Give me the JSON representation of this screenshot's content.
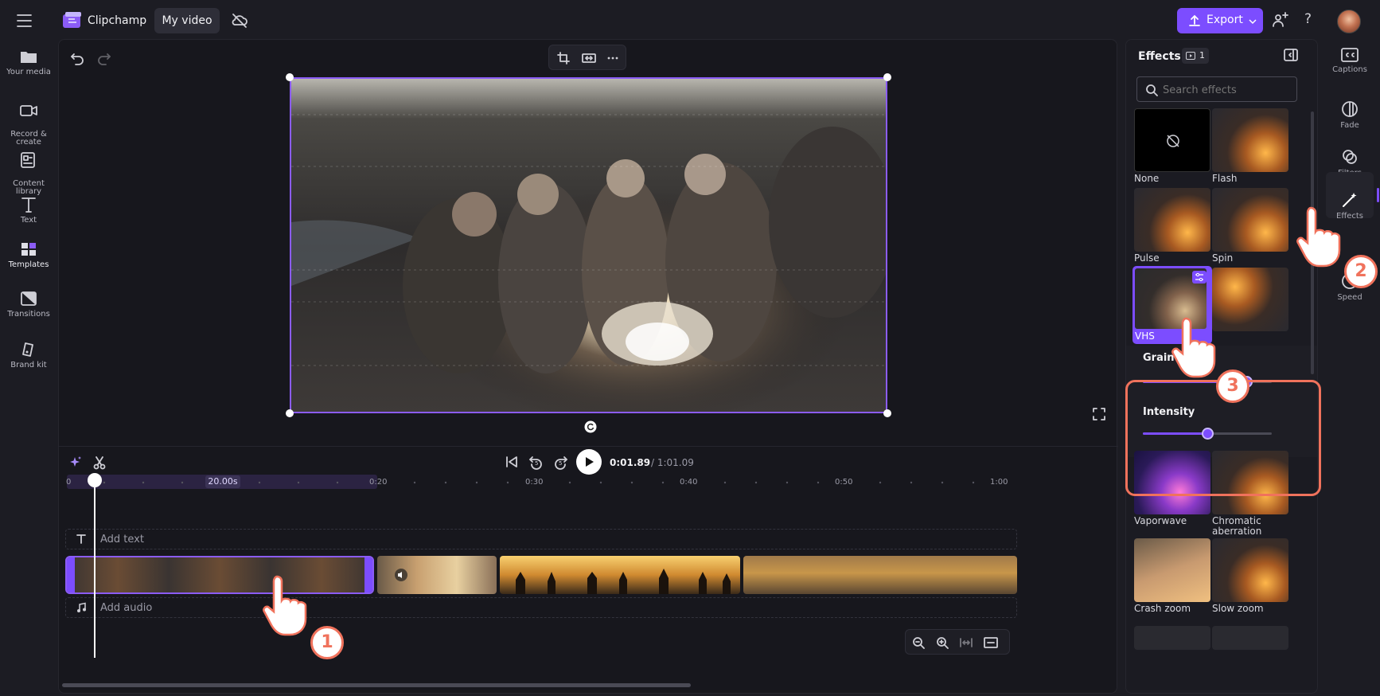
{
  "app": {
    "name": "Clipchamp",
    "project_title": "My video"
  },
  "header": {
    "export_label": "Export",
    "help_label": "?"
  },
  "leftnav": {
    "items": [
      {
        "label": "Your media"
      },
      {
        "label": "Record &\ncreate"
      },
      {
        "label": "Content\nlibrary"
      },
      {
        "label": "Text"
      },
      {
        "label": "Templates"
      },
      {
        "label": "Transitions"
      },
      {
        "label": "Brand kit"
      }
    ]
  },
  "rightnav": {
    "items": [
      {
        "label": "Captions"
      },
      {
        "label": "Fade"
      },
      {
        "label": "Filters"
      },
      {
        "label": "Effects"
      },
      {
        "label": "Speed"
      }
    ]
  },
  "playback": {
    "current_time": "0:01.89",
    "total_time": "/ 1:01.09",
    "rewind_label": "5",
    "forward_label": "5"
  },
  "timeline": {
    "ruler": [
      "0",
      "0:20",
      "0:30",
      "0:40",
      "0:50",
      "1:00"
    ],
    "selection_duration": "20.00s",
    "add_text_label": "Add text",
    "add_audio_label": "Add audio"
  },
  "effects_panel": {
    "title": "Effects",
    "badge_count": "1",
    "search_placeholder": "Search effects",
    "effects": [
      {
        "label": "None"
      },
      {
        "label": "Flash"
      },
      {
        "label": "Pulse"
      },
      {
        "label": "Spin"
      },
      {
        "label": "VHS",
        "selected": true
      },
      {
        "label": "Vaporwave"
      },
      {
        "label": "Chromatic\naberration"
      },
      {
        "label": "Crash zoom"
      },
      {
        "label": "Slow zoom"
      }
    ],
    "sliders": [
      {
        "label": "Grain",
        "value": 0.8
      },
      {
        "label": "Intensity",
        "value": 0.5
      }
    ]
  },
  "callouts": [
    "1",
    "2",
    "3"
  ],
  "colors": {
    "accent": "#7c4dff",
    "callout": "#f0725c",
    "bg": "#1c1c23"
  }
}
